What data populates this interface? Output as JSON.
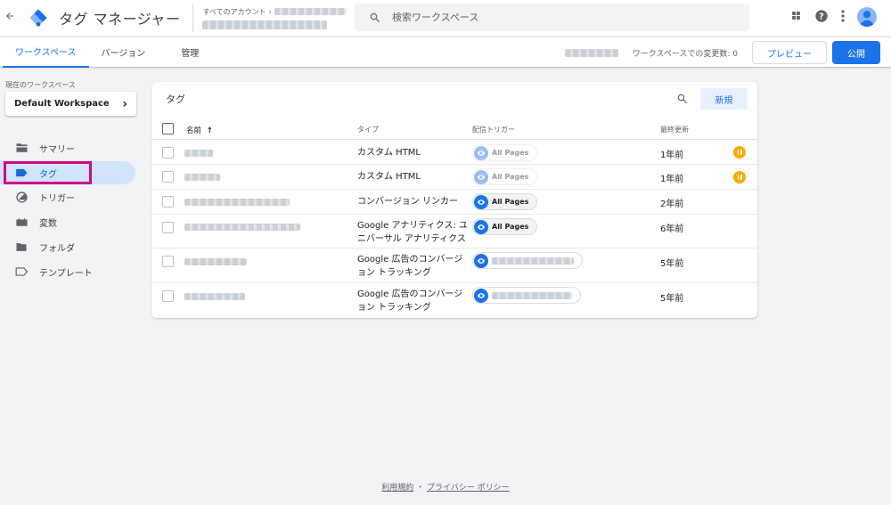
{
  "header": {
    "back_icon": "arrow-back-icon",
    "logo_color": "#1a73e8",
    "app_title": "タグ マネージャー",
    "account_breadcrumb": "すべてのアカウント",
    "search_placeholder": "検索ワークスペース"
  },
  "nav": {
    "tabs": [
      {
        "label": "ワークスペース",
        "active": true
      },
      {
        "label": "バージョン",
        "active": false
      },
      {
        "label": "管理",
        "active": false
      }
    ],
    "changes_label": "ワークスペースでの変更数: 0",
    "preview_label": "プレビュー",
    "publish_label": "公開",
    "accent": "#1a73e8"
  },
  "sidebar": {
    "workspace_label": "現在のワークスペース",
    "workspace_name": "Default Workspace",
    "items": [
      {
        "label": "サマリー",
        "icon": "folder-open-icon",
        "active": false
      },
      {
        "label": "タグ",
        "icon": "tag-icon",
        "active": true
      },
      {
        "label": "トリガー",
        "icon": "trigger-icon",
        "active": false
      },
      {
        "label": "変数",
        "icon": "variables-icon",
        "active": false
      },
      {
        "label": "フォルダ",
        "icon": "folder-icon",
        "active": false
      },
      {
        "label": "テンプレート",
        "icon": "template-icon",
        "active": false
      }
    ],
    "highlight_color": "#cc0a8a"
  },
  "tags": {
    "title": "タグ",
    "new_label": "新規",
    "columns": {
      "name": "名前",
      "type": "タイプ",
      "trigger": "配信トリガー",
      "updated": "最終更新"
    },
    "rows": [
      {
        "type": "カスタム HTML",
        "trigger": "All Pages",
        "updated": "1年前",
        "paused": true
      },
      {
        "type": "カスタム HTML",
        "trigger": "All Pages",
        "updated": "1年前",
        "paused": true
      },
      {
        "type": "コンバージョン リンカー",
        "trigger": "All Pages",
        "updated": "2年前",
        "paused": false
      },
      {
        "type": "Google アナリティクス: ユニバーサル アナリティクス",
        "trigger": "All Pages",
        "updated": "6年前",
        "paused": false
      },
      {
        "type": "Google 広告のコンバージョン トラッキング",
        "trigger": "",
        "updated": "5年前",
        "paused": false
      },
      {
        "type": "Google 広告のコンバージョン トラッキング",
        "trigger": "",
        "updated": "5年前",
        "paused": false
      }
    ],
    "paused_color": "#f9ab00"
  },
  "footer": {
    "terms": "利用規約",
    "separator": "・",
    "privacy": "プライバシー ポリシー"
  }
}
